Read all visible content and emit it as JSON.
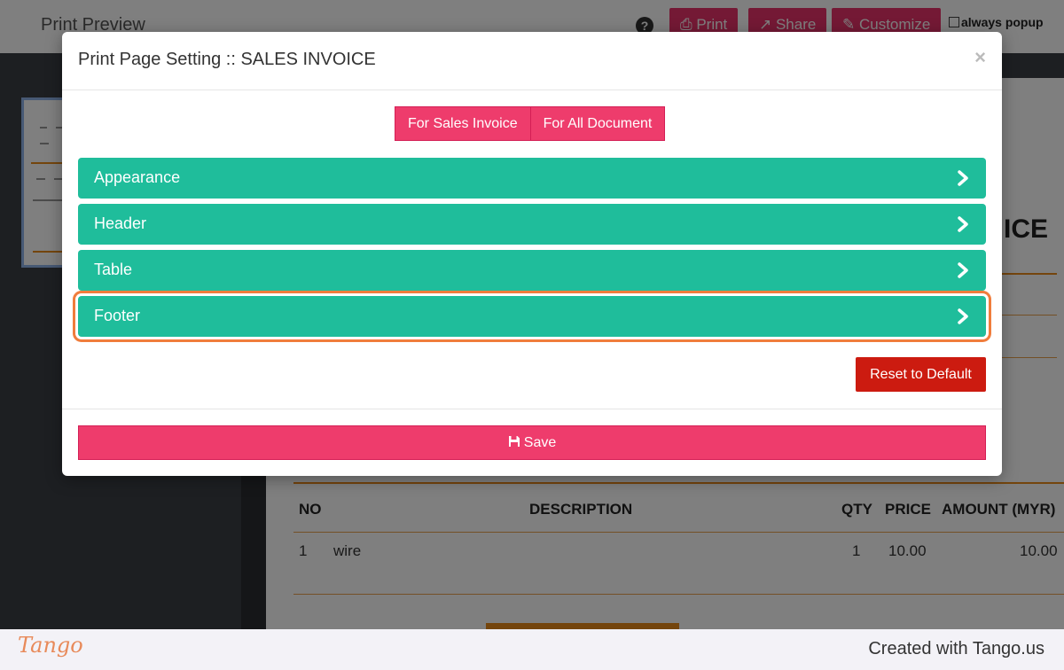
{
  "background": {
    "title": "Print Preview",
    "help_icon": "question-circle-icon",
    "buttons": {
      "print": "Print",
      "share": "Share",
      "customize": "Customize"
    },
    "always_popup": "always popup",
    "doc_title_fragment": "ICE",
    "table_headers": {
      "no": "NO",
      "description": "DESCRIPTION",
      "qty": "QTY",
      "price": "PRICE",
      "amount": "AMOUNT (MYR)"
    },
    "row": {
      "no": "1",
      "description": "wire",
      "qty": "1",
      "price": "10.00",
      "amount": "10.00"
    }
  },
  "modal": {
    "title": "Print Page Setting :: SALES INVOICE",
    "close": "×",
    "tabs": [
      {
        "label": "For Sales Invoice"
      },
      {
        "label": "For All Document"
      }
    ],
    "sections": [
      {
        "label": "Appearance"
      },
      {
        "label": "Header"
      },
      {
        "label": "Table"
      },
      {
        "label": "Footer"
      }
    ],
    "reset_label": "Reset to Default",
    "save_label": "Save"
  },
  "footer": {
    "logo": "Tango",
    "credit": "Created with Tango.us"
  },
  "colors": {
    "accent_pink": "#ee3c6c",
    "section_teal": "#1fbd9b",
    "reset_red": "#cc1b10",
    "highlight_orange": "#f07d3c"
  }
}
